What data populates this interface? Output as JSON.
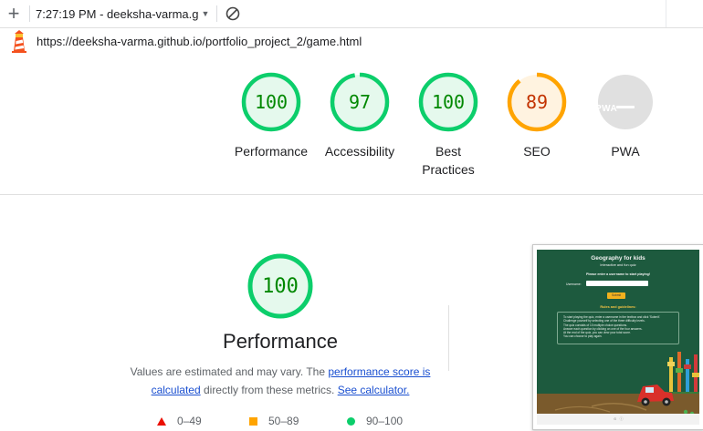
{
  "toolbar": {
    "session_label": "7:27:19 PM - deeksha-varma.g"
  },
  "urlbar": {
    "url": "https://deeksha-varma.github.io/portfolio_project_2/game.html"
  },
  "gauges": [
    {
      "label": "Performance",
      "score": "100",
      "fraction": 1.0,
      "color": "#0cce6b",
      "text_color": "#008800",
      "fill": "#e5f9ed"
    },
    {
      "label": "Accessibility",
      "score": "97",
      "fraction": 0.97,
      "color": "#0cce6b",
      "text_color": "#008800",
      "fill": "#e5f9ed"
    },
    {
      "label": "Best Practices",
      "score": "100",
      "fraction": 1.0,
      "color": "#0cce6b",
      "text_color": "#008800",
      "fill": "#e5f9ed"
    },
    {
      "label": "SEO",
      "score": "89",
      "fraction": 0.89,
      "color": "#ffa400",
      "text_color": "#c33300",
      "fill": "#fff3e0"
    },
    {
      "label": "PWA",
      "score": "",
      "badge_text": "PWA",
      "fraction": 0,
      "color": "#e0e0e0",
      "text_color": "#ffffff",
      "fill": "#e0e0e0"
    }
  ],
  "performance": {
    "score": "100",
    "fraction": 1.0,
    "title": "Performance",
    "desc_before": "Values are estimated and may vary. The ",
    "desc_link1": "performance score is calculated",
    "desc_middle": " directly from these metrics. ",
    "desc_link2": "See calculator."
  },
  "legend": [
    {
      "range": "0–49",
      "color": "#eb0f00"
    },
    {
      "range": "50–89",
      "color": "#ffa400"
    },
    {
      "range": "90–100",
      "color": "#0cce6b"
    }
  ],
  "thumbnail": {
    "title": "Geography for kids",
    "subtitle": "Interactive and fun quiz",
    "enter_prompt": "Please enter a username to start playing!",
    "username_label": "Username:",
    "submit_label": "Submit",
    "rules_title": "Rules and guidelines:",
    "rules": [
      "To start playing the quiz, enter a username in the textbox and click 'Submit'.",
      "Challenge yourself by selecting one of the three difficulty levels.",
      "The quiz consists of 10 multiple choice questions.",
      "Answer each question by clicking on one of the four answers.",
      "At the end of the quiz, you can view your total score.",
      "You can choose to play again."
    ]
  }
}
